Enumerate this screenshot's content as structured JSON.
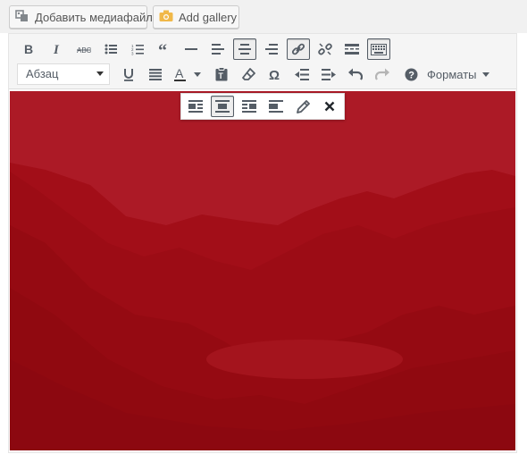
{
  "media_buttons": {
    "add_media_label": "Добавить медиафайл",
    "add_gallery_label": "Add gallery"
  },
  "toolbar": {
    "row1": [
      "bold-icon",
      "italic-icon",
      "strikethrough-icon",
      "bulleted-list-icon",
      "numbered-list-icon",
      "blockquote-icon",
      "horizontal-line-icon",
      "align-left-icon",
      "align-center-icon",
      "align-right-icon",
      "link-icon",
      "unlink-icon",
      "read-more-icon",
      "toolbar-toggle-icon"
    ],
    "row2": [
      "underline-icon",
      "justify-icon",
      "text-color-icon",
      "paste-text-icon",
      "clear-formatting-icon",
      "special-character-icon",
      "outdent-icon",
      "indent-icon",
      "undo-icon",
      "redo-icon",
      "help-icon"
    ],
    "paragraph_select": "Абзац",
    "formats_label": "Форматы",
    "active": [
      "align-center-icon",
      "link-icon",
      "toolbar-toggle-icon"
    ],
    "disabled": [
      "redo-icon"
    ]
  },
  "image_toolbar": {
    "buttons": [
      "image-align-left-icon",
      "image-align-center-icon",
      "image-align-right-icon",
      "image-align-none-icon",
      "edit-image-icon",
      "remove-image-icon"
    ],
    "active": "image-align-center-icon"
  },
  "content": {
    "image": {
      "description_tint": "#b20a12",
      "subject": "mountain-lake-landscape"
    }
  },
  "colors": {
    "toolbar_bg": "#f5f5f5",
    "icon": "#555d66",
    "image_tint": "#b20a12",
    "gallery_icon": "#f0b849"
  }
}
